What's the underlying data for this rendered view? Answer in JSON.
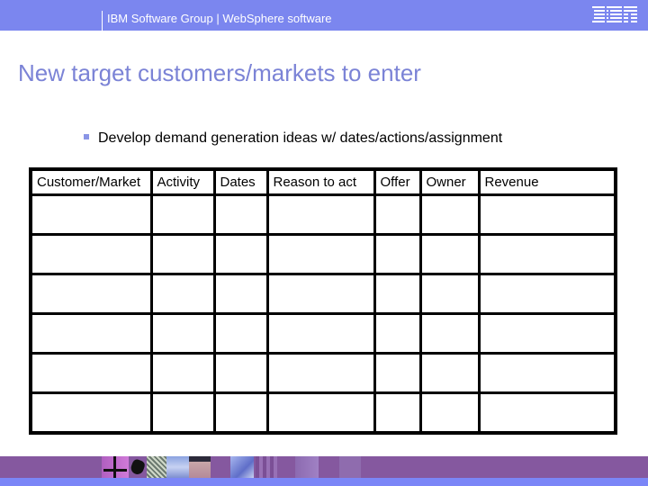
{
  "header": {
    "group_label": "IBM Software Group | WebSphere software",
    "logo_text": "IBM",
    "logo_icon": "ibm-logo-icon",
    "bar_color": "#7b86ef"
  },
  "slide": {
    "title": "New target customers/markets to enter",
    "title_color": "#7b83d6",
    "bullet": "Develop demand generation ideas w/ dates/actions/assignment",
    "bullet_icon": "square-bullet-icon"
  },
  "table": {
    "columns": [
      "Customer/Market",
      "Activity",
      "Dates",
      "Reason to act",
      "Offer",
      "Owner",
      "Revenue"
    ],
    "rows": [
      [
        "",
        "",
        "",
        "",
        "",
        "",
        ""
      ],
      [
        "",
        "",
        "",
        "",
        "",
        "",
        ""
      ],
      [
        "",
        "",
        "",
        "",
        "",
        "",
        ""
      ],
      [
        "",
        "",
        "",
        "",
        "",
        "",
        ""
      ],
      [
        "",
        "",
        "",
        "",
        "",
        "",
        ""
      ],
      [
        "",
        "",
        "",
        "",
        "",
        "",
        ""
      ]
    ]
  },
  "footer": {
    "band_color": "#85589f",
    "strip_color": "#7b86f7",
    "images": [
      "crosshair-image",
      "hand-image",
      "grid-building-image",
      "sky-image",
      "face-image",
      "figure-image",
      "bars-image"
    ]
  }
}
